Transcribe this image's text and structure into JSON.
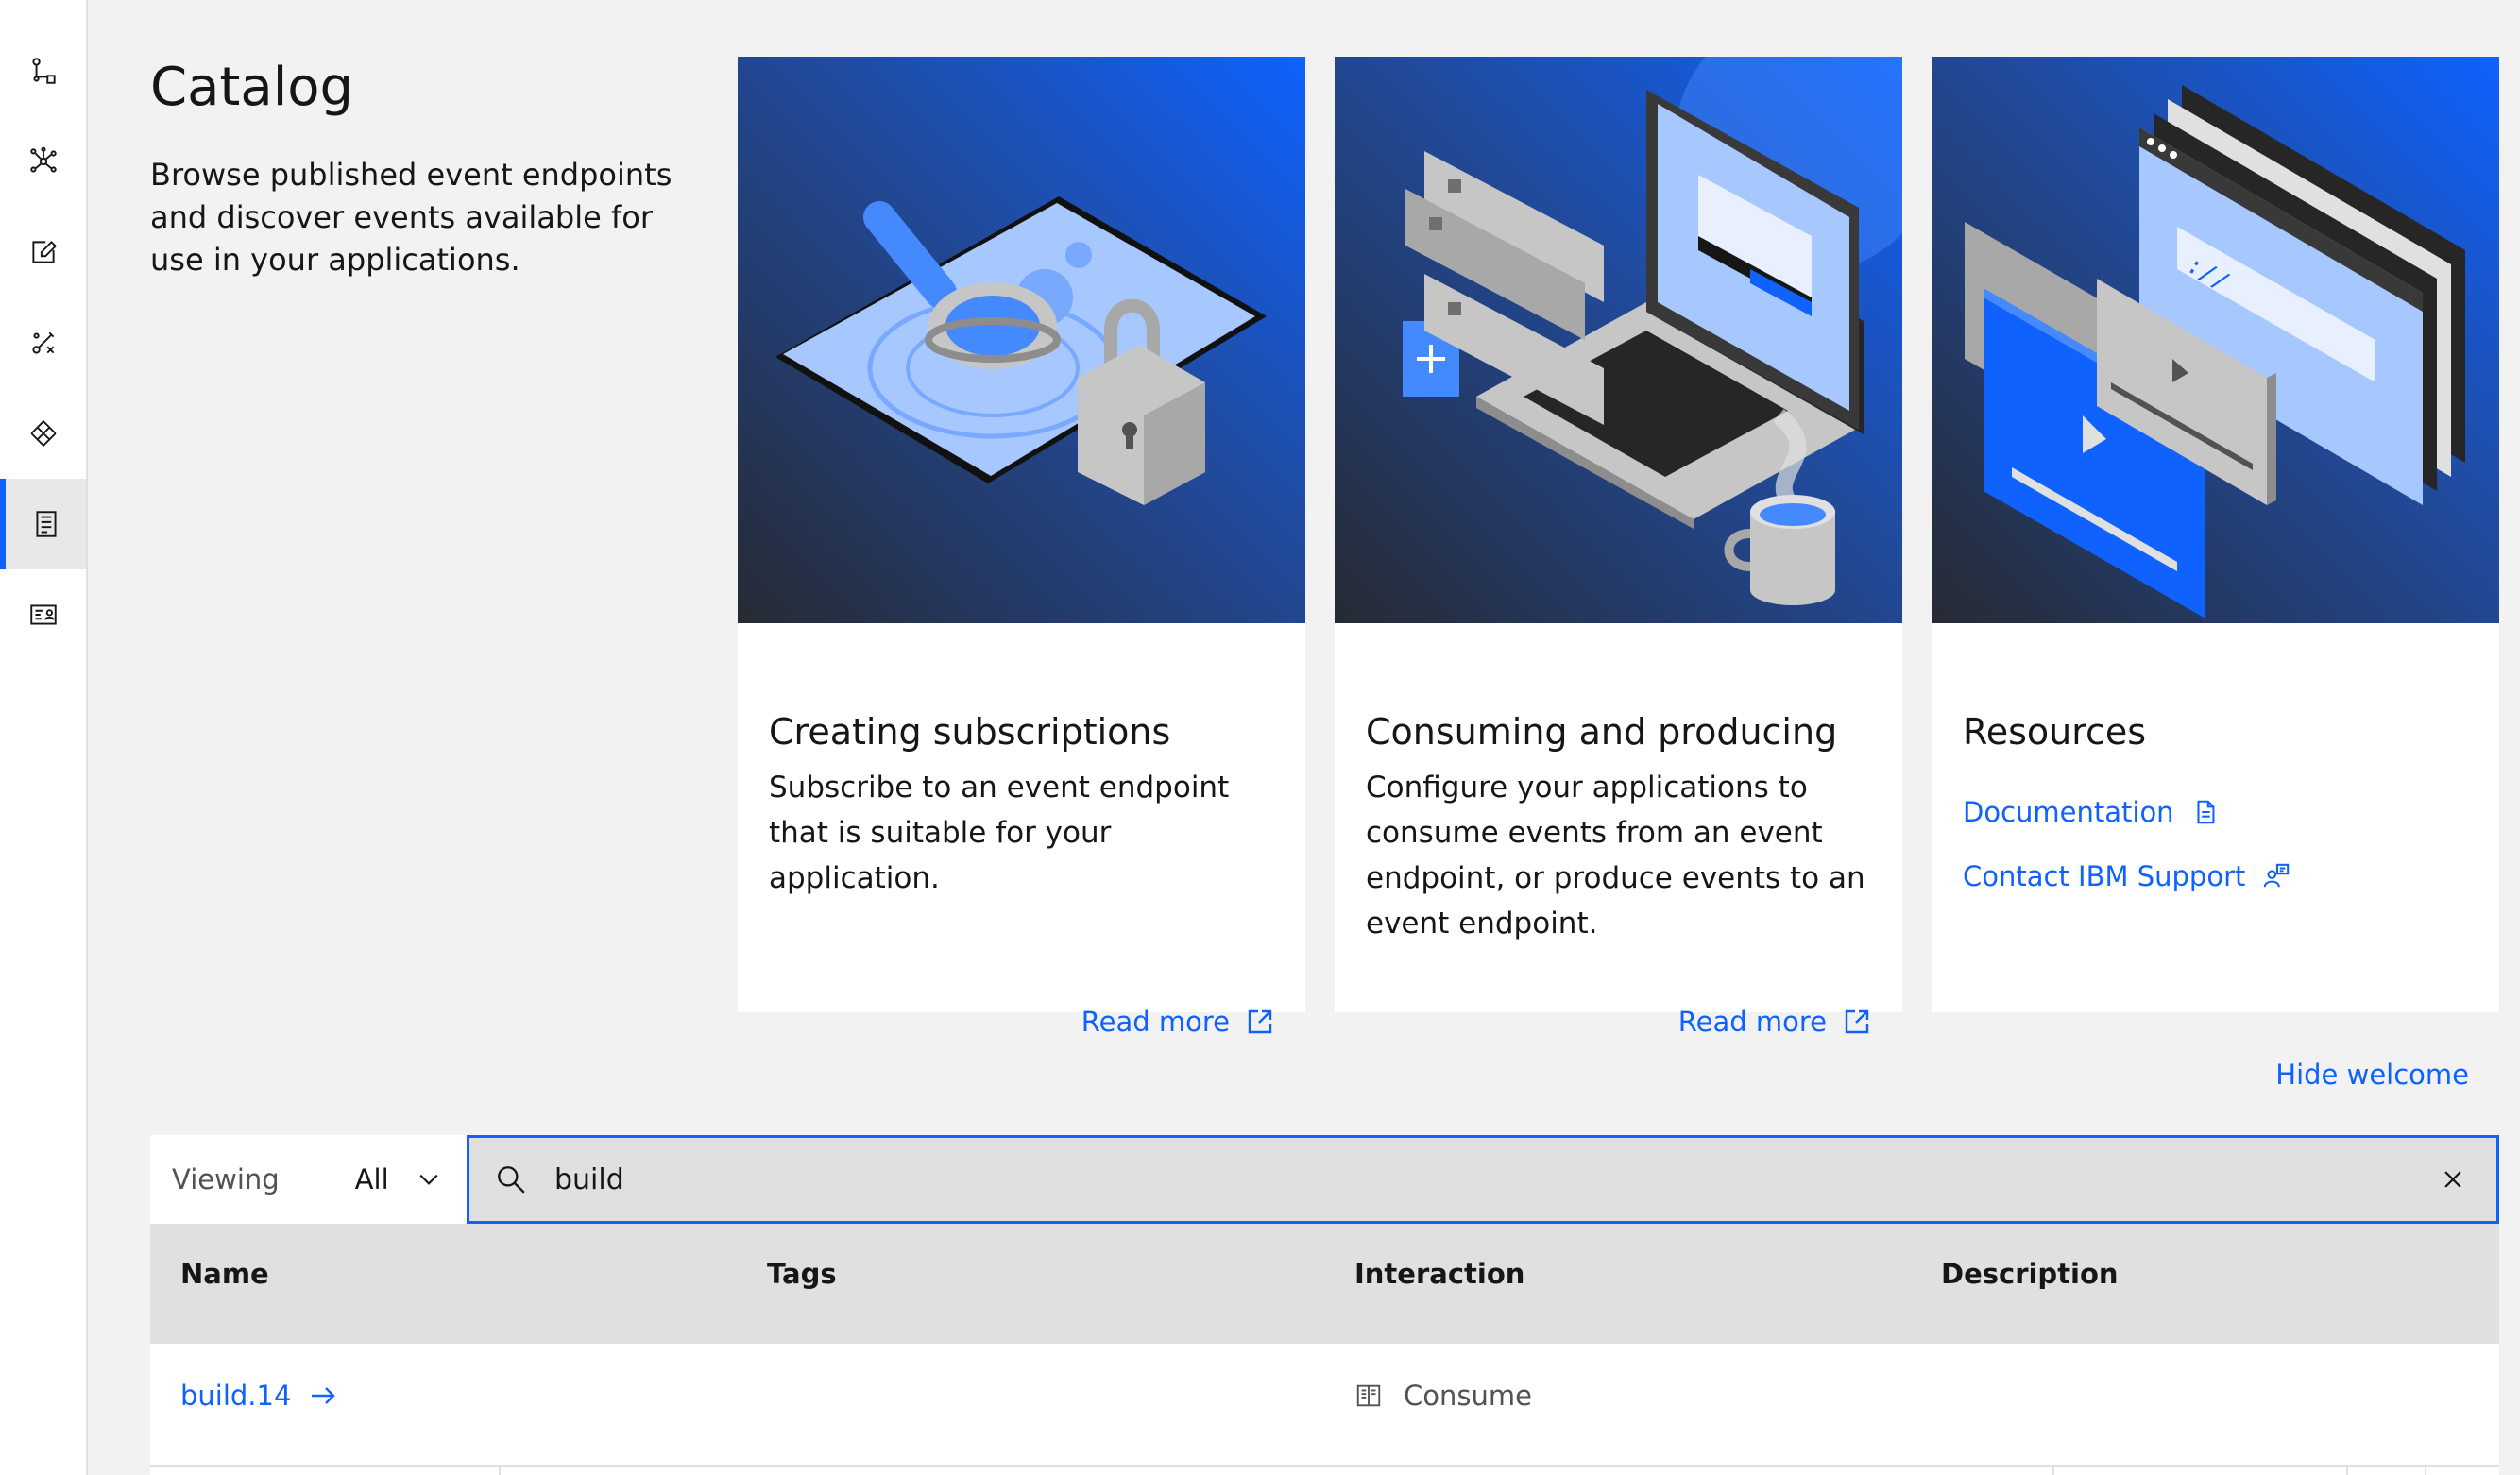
{
  "page": {
    "title": "Catalog",
    "intro": "Browse published event endpoints and discover events available for use in your applications."
  },
  "rail": {
    "items": [
      {
        "icon": "flow-connection-icon"
      },
      {
        "icon": "network-topology-icon"
      },
      {
        "icon": "edit-icon"
      },
      {
        "icon": "tools-icon"
      },
      {
        "icon": "integration-icon"
      },
      {
        "icon": "catalog-icon",
        "active": true
      },
      {
        "icon": "subscriptions-id-card-icon"
      }
    ]
  },
  "cards": [
    {
      "title": "Creating subscriptions",
      "body": "Subscribe to an event endpoint that is suitable for your application.",
      "link": "Read more",
      "art": "magnifier-lock-illustration"
    },
    {
      "title": "Consuming and producing",
      "body": "Configure your applications to consume events from an event endpoint, or produce events to an event endpoint.",
      "link": "Read more",
      "art": "laptop-coffee-illustration"
    },
    {
      "title": "Resources",
      "links": [
        {
          "label": "Documentation",
          "icon": "document-icon"
        },
        {
          "label": "Contact IBM Support",
          "icon": "support-icon"
        }
      ],
      "art": "browser-windows-illustration"
    }
  ],
  "hide_welcome": "Hide welcome",
  "toolbar": {
    "viewing_label": "Viewing",
    "viewing_value": "All",
    "search_value": "build"
  },
  "table": {
    "columns": [
      "Name",
      "Tags",
      "Interaction",
      "Description"
    ],
    "rows": [
      {
        "name": "build.14",
        "tags": "",
        "interaction": "Consume",
        "description": ""
      }
    ]
  },
  "colors": {
    "accent": "#0f62fe",
    "background": "#f2f2f2",
    "header_bg": "#e0e0e0"
  }
}
